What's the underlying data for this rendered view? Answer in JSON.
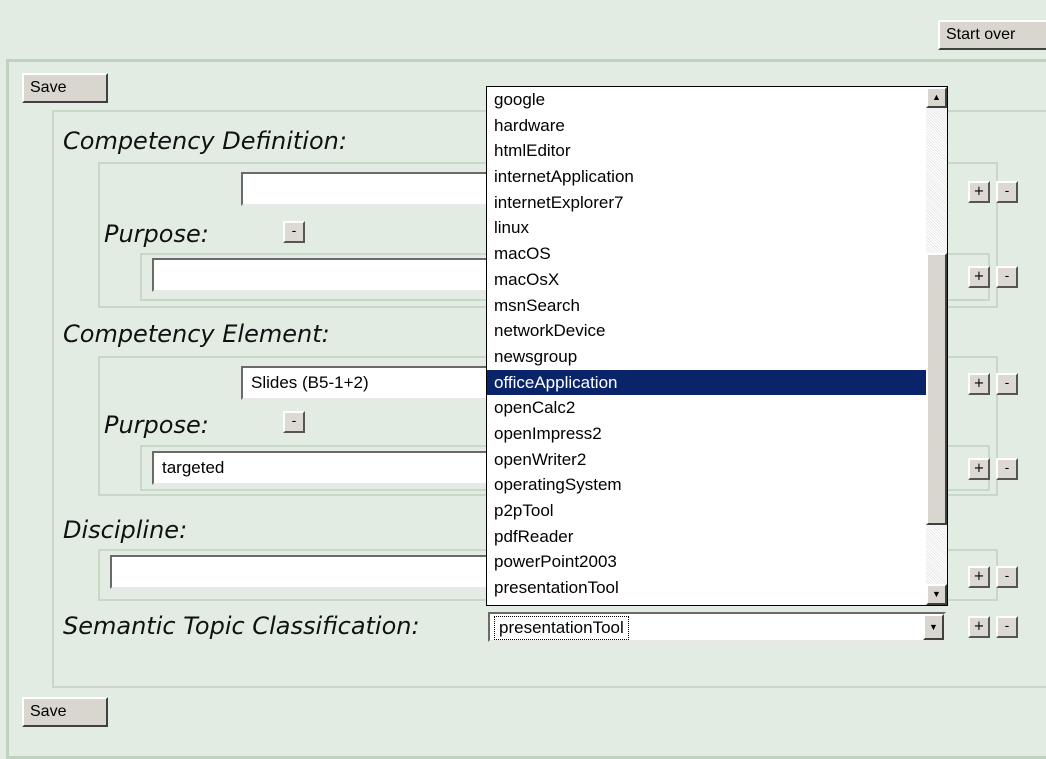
{
  "header": {
    "start_over_label": "Start over"
  },
  "form": {
    "save_label": "Save",
    "save_bottom_label": "Save"
  },
  "sections": {
    "competency_definition": {
      "title": "Competency Definition:",
      "value": "",
      "purpose_label": "Purpose:",
      "purpose_value": ""
    },
    "competency_element": {
      "title": "Competency Element:",
      "value": "Slides (B5-1+2)",
      "purpose_label": "Purpose:",
      "purpose_value": "targeted"
    },
    "discipline": {
      "title": "Discipline:",
      "value": ""
    },
    "semantic_topic": {
      "title": "Semantic Topic Classification:",
      "selected_value": "presentationTool"
    }
  },
  "controls": {
    "add_symbol": "+",
    "remove_symbol": "-"
  },
  "dropdown": {
    "items": [
      "google",
      "hardware",
      "htmlEditor",
      "internetApplication",
      "internetExplorer7",
      "linux",
      "macOS",
      "macOsX",
      "msnSearch",
      "networkDevice",
      "newsgroup",
      "officeApplication",
      "openCalc2",
      "openImpress2",
      "openWriter2",
      "operatingSystem",
      "p2pTool",
      "pdfReader",
      "powerPoint2003",
      "presentationTool"
    ],
    "highlighted": "officeApplication",
    "scroll_up_icon": "▲",
    "scroll_down_icon": "▼"
  },
  "colors": {
    "page_background": "#e3ece3",
    "panel_border": "#bfd2bf",
    "selection_background": "#0a246a"
  }
}
